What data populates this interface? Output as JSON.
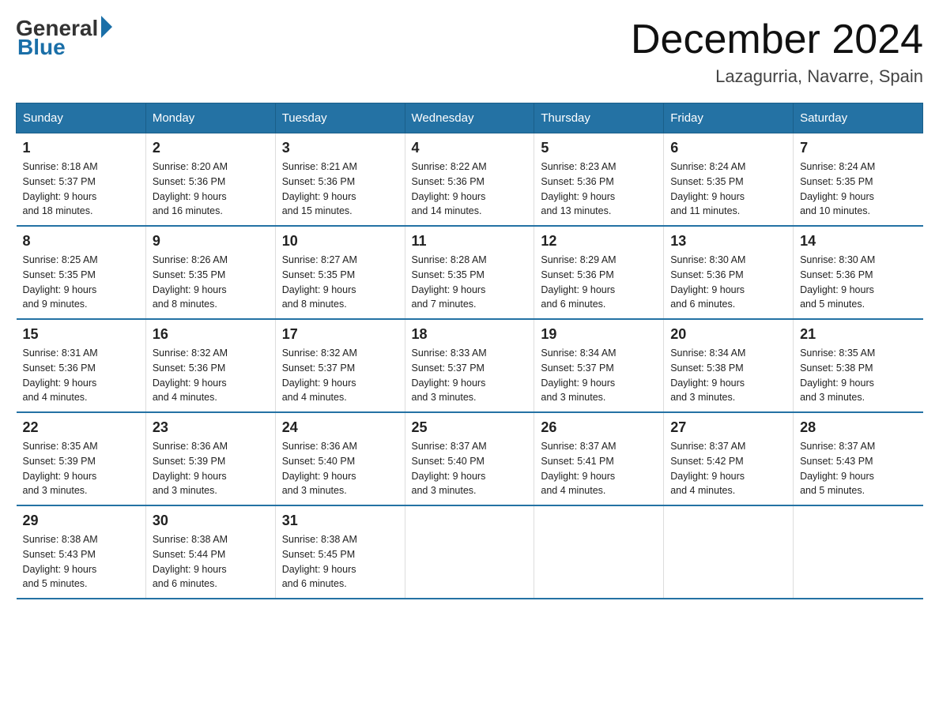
{
  "logo": {
    "general": "General",
    "blue": "Blue"
  },
  "header": {
    "month_title": "December 2024",
    "location": "Lazagurria, Navarre, Spain"
  },
  "days_of_week": [
    "Sunday",
    "Monday",
    "Tuesday",
    "Wednesday",
    "Thursday",
    "Friday",
    "Saturday"
  ],
  "weeks": [
    [
      {
        "day": "1",
        "sunrise": "8:18 AM",
        "sunset": "5:37 PM",
        "daylight": "9 hours and 18 minutes."
      },
      {
        "day": "2",
        "sunrise": "8:20 AM",
        "sunset": "5:36 PM",
        "daylight": "9 hours and 16 minutes."
      },
      {
        "day": "3",
        "sunrise": "8:21 AM",
        "sunset": "5:36 PM",
        "daylight": "9 hours and 15 minutes."
      },
      {
        "day": "4",
        "sunrise": "8:22 AM",
        "sunset": "5:36 PM",
        "daylight": "9 hours and 14 minutes."
      },
      {
        "day": "5",
        "sunrise": "8:23 AM",
        "sunset": "5:36 PM",
        "daylight": "9 hours and 13 minutes."
      },
      {
        "day": "6",
        "sunrise": "8:24 AM",
        "sunset": "5:35 PM",
        "daylight": "9 hours and 11 minutes."
      },
      {
        "day": "7",
        "sunrise": "8:24 AM",
        "sunset": "5:35 PM",
        "daylight": "9 hours and 10 minutes."
      }
    ],
    [
      {
        "day": "8",
        "sunrise": "8:25 AM",
        "sunset": "5:35 PM",
        "daylight": "9 hours and 9 minutes."
      },
      {
        "day": "9",
        "sunrise": "8:26 AM",
        "sunset": "5:35 PM",
        "daylight": "9 hours and 8 minutes."
      },
      {
        "day": "10",
        "sunrise": "8:27 AM",
        "sunset": "5:35 PM",
        "daylight": "9 hours and 8 minutes."
      },
      {
        "day": "11",
        "sunrise": "8:28 AM",
        "sunset": "5:35 PM",
        "daylight": "9 hours and 7 minutes."
      },
      {
        "day": "12",
        "sunrise": "8:29 AM",
        "sunset": "5:36 PM",
        "daylight": "9 hours and 6 minutes."
      },
      {
        "day": "13",
        "sunrise": "8:30 AM",
        "sunset": "5:36 PM",
        "daylight": "9 hours and 6 minutes."
      },
      {
        "day": "14",
        "sunrise": "8:30 AM",
        "sunset": "5:36 PM",
        "daylight": "9 hours and 5 minutes."
      }
    ],
    [
      {
        "day": "15",
        "sunrise": "8:31 AM",
        "sunset": "5:36 PM",
        "daylight": "9 hours and 4 minutes."
      },
      {
        "day": "16",
        "sunrise": "8:32 AM",
        "sunset": "5:36 PM",
        "daylight": "9 hours and 4 minutes."
      },
      {
        "day": "17",
        "sunrise": "8:32 AM",
        "sunset": "5:37 PM",
        "daylight": "9 hours and 4 minutes."
      },
      {
        "day": "18",
        "sunrise": "8:33 AM",
        "sunset": "5:37 PM",
        "daylight": "9 hours and 3 minutes."
      },
      {
        "day": "19",
        "sunrise": "8:34 AM",
        "sunset": "5:37 PM",
        "daylight": "9 hours and 3 minutes."
      },
      {
        "day": "20",
        "sunrise": "8:34 AM",
        "sunset": "5:38 PM",
        "daylight": "9 hours and 3 minutes."
      },
      {
        "day": "21",
        "sunrise": "8:35 AM",
        "sunset": "5:38 PM",
        "daylight": "9 hours and 3 minutes."
      }
    ],
    [
      {
        "day": "22",
        "sunrise": "8:35 AM",
        "sunset": "5:39 PM",
        "daylight": "9 hours and 3 minutes."
      },
      {
        "day": "23",
        "sunrise": "8:36 AM",
        "sunset": "5:39 PM",
        "daylight": "9 hours and 3 minutes."
      },
      {
        "day": "24",
        "sunrise": "8:36 AM",
        "sunset": "5:40 PM",
        "daylight": "9 hours and 3 minutes."
      },
      {
        "day": "25",
        "sunrise": "8:37 AM",
        "sunset": "5:40 PM",
        "daylight": "9 hours and 3 minutes."
      },
      {
        "day": "26",
        "sunrise": "8:37 AM",
        "sunset": "5:41 PM",
        "daylight": "9 hours and 4 minutes."
      },
      {
        "day": "27",
        "sunrise": "8:37 AM",
        "sunset": "5:42 PM",
        "daylight": "9 hours and 4 minutes."
      },
      {
        "day": "28",
        "sunrise": "8:37 AM",
        "sunset": "5:43 PM",
        "daylight": "9 hours and 5 minutes."
      }
    ],
    [
      {
        "day": "29",
        "sunrise": "8:38 AM",
        "sunset": "5:43 PM",
        "daylight": "9 hours and 5 minutes."
      },
      {
        "day": "30",
        "sunrise": "8:38 AM",
        "sunset": "5:44 PM",
        "daylight": "9 hours and 6 minutes."
      },
      {
        "day": "31",
        "sunrise": "8:38 AM",
        "sunset": "5:45 PM",
        "daylight": "9 hours and 6 minutes."
      },
      null,
      null,
      null,
      null
    ]
  ],
  "labels": {
    "sunrise": "Sunrise:",
    "sunset": "Sunset:",
    "daylight": "Daylight:"
  }
}
